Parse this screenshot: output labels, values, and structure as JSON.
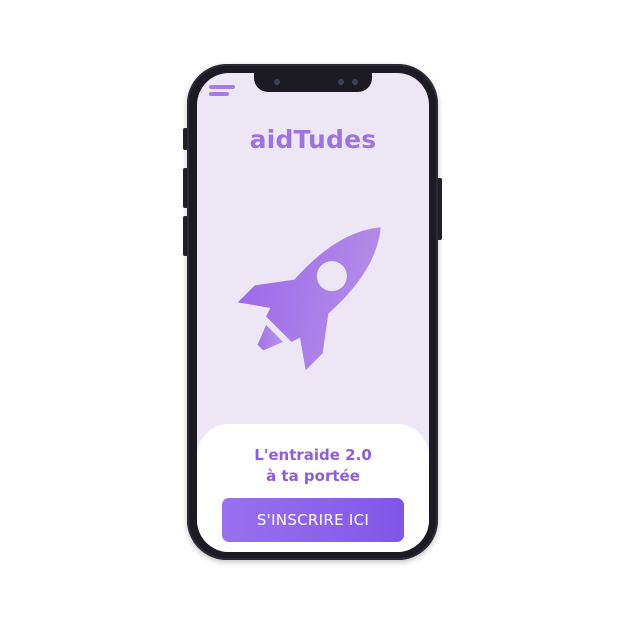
{
  "app": {
    "logo": "aidTudes"
  },
  "hero": {
    "tagline_line1": "L'entraide 2.0",
    "tagline_line2": "à ta portée"
  },
  "cta": {
    "label": "S'INSCRIRE ICI"
  },
  "icons": {
    "menu": "hamburger-menu-icon",
    "hero": "rocket-icon"
  },
  "colors": {
    "accent": "#9e73df",
    "screen_bg": "#ece6f5",
    "button_start": "#9a70f0",
    "button_end": "#8156e8",
    "phone_frame": "#1c1b24"
  }
}
